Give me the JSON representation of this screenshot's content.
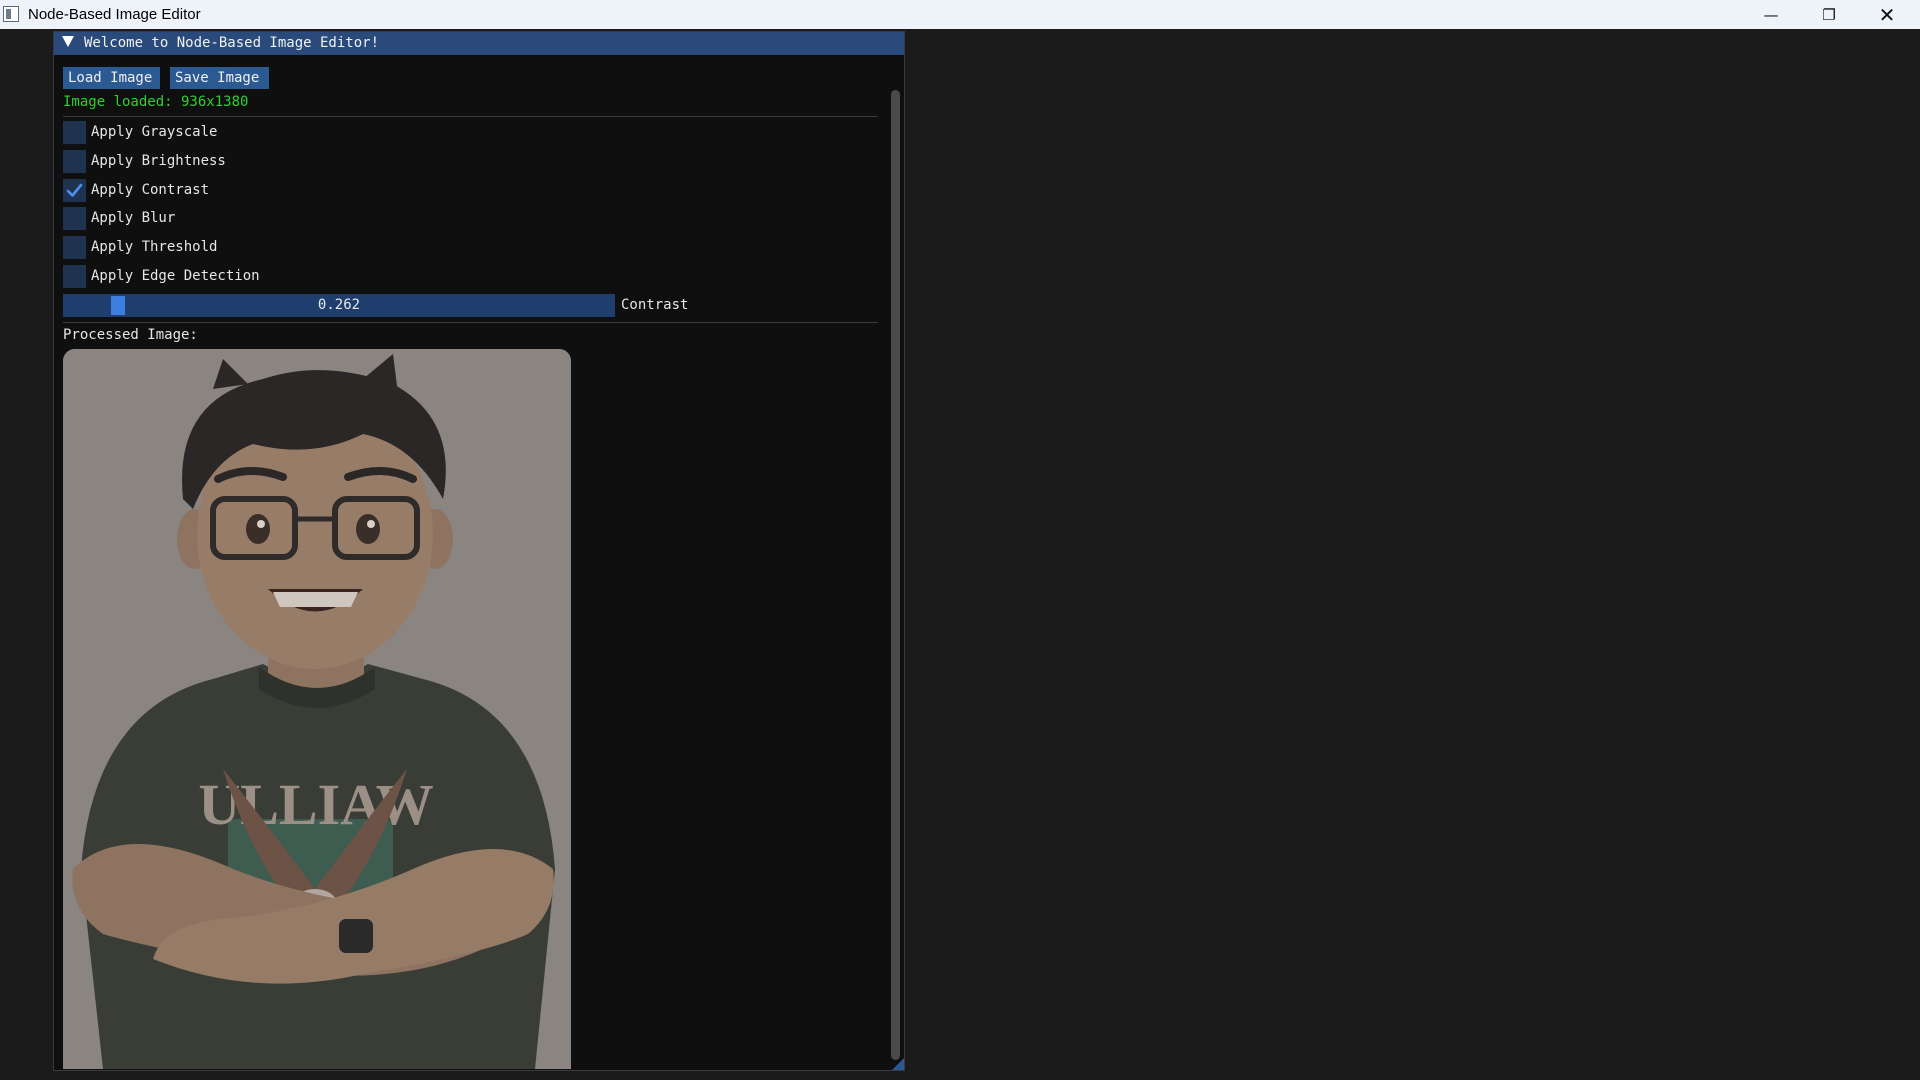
{
  "window": {
    "title": "Node-Based Image Editor",
    "controls": {
      "minimize": "—",
      "maximize": "❐",
      "close": "✕"
    }
  },
  "panel": {
    "header": "Welcome to Node-Based Image Editor!",
    "buttons": {
      "load": "Load Image",
      "save": "Save Image"
    },
    "status": "Image loaded: 936x1380",
    "filters": [
      {
        "label": "Apply Grayscale",
        "checked": false
      },
      {
        "label": "Apply Brightness",
        "checked": false
      },
      {
        "label": "Apply Contrast",
        "checked": true
      },
      {
        "label": "Apply Blur",
        "checked": false
      },
      {
        "label": "Apply Threshold",
        "checked": false
      },
      {
        "label": "Apply Edge Detection",
        "checked": false
      }
    ],
    "slider": {
      "value": "0.262",
      "label": "Contrast"
    },
    "processed_label": "Processed Image:",
    "image": {
      "shirt_text": "ULLIAW"
    }
  },
  "colors": {
    "accent": "#2b5a92",
    "header_bg": "#294a7a",
    "status_green": "#2fd12f",
    "checkmark": "#4a90f0"
  }
}
